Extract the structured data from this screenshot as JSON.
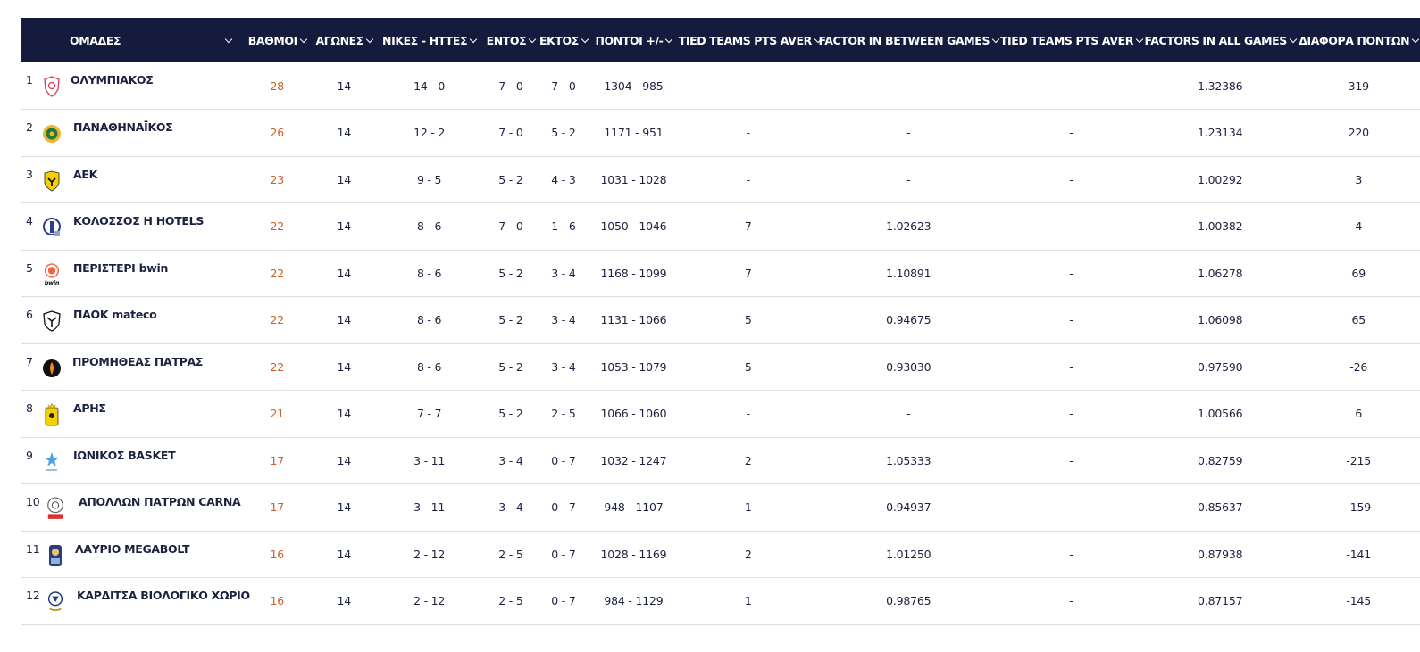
{
  "headers": {
    "team": "ΟΜΑΔΕΣ",
    "points": "ΒΑΘΜΟΙ",
    "games": "ΑΓΩΝΕΣ",
    "wl": "ΝΙΚΕΣ - ΗΤΤΕΣ",
    "home": "ΕΝΤΟΣ",
    "away": "ΕΚΤΟΣ",
    "ptsdiff": "ΠΟΝΤΟΙ +/-",
    "tied1": "TIED TEAMS PTS AVER",
    "factor_between": "FACTOR IN BETWEEN GAMES",
    "tied2": "TIED TEAMS PTS AVER",
    "factor_all": "FACTORS IN ALL GAMES",
    "diff": "ΔΙΑΦΟΡΑ ΠΟΝΤΩΝ"
  },
  "rows": [
    {
      "pos": "1",
      "team": "ΟΛΥΜΠΙΑΚΟΣ",
      "logo": "olympiakos-logo",
      "points": "28",
      "games": "14",
      "wl": "14 - 0",
      "home": "7 - 0",
      "away": "7 - 0",
      "ptsdiff": "1304 - 985",
      "tied1": "-",
      "factor_between": "-",
      "tied2": "-",
      "factor_all": "1.32386",
      "diff": "319"
    },
    {
      "pos": "2",
      "team": "ΠΑΝΑΘΗΝΑΪΚΟΣ",
      "logo": "panathinaikos-logo",
      "points": "26",
      "games": "14",
      "wl": "12 - 2",
      "home": "7 - 0",
      "away": "5 - 2",
      "ptsdiff": "1171 - 951",
      "tied1": "-",
      "factor_between": "-",
      "tied2": "-",
      "factor_all": "1.23134",
      "diff": "220"
    },
    {
      "pos": "3",
      "team": "ΑΕΚ",
      "logo": "aek-logo",
      "points": "23",
      "games": "14",
      "wl": "9 - 5",
      "home": "5 - 2",
      "away": "4 - 3",
      "ptsdiff": "1031 - 1028",
      "tied1": "-",
      "factor_between": "-",
      "tied2": "-",
      "factor_all": "1.00292",
      "diff": "3"
    },
    {
      "pos": "4",
      "team": "ΚΟΛΟΣΣΟΣ H HOTELS",
      "logo": "kolossos-logo",
      "points": "22",
      "games": "14",
      "wl": "8 - 6",
      "home": "7 - 0",
      "away": "1 - 6",
      "ptsdiff": "1050 - 1046",
      "tied1": "7",
      "factor_between": "1.02623",
      "tied2": "-",
      "factor_all": "1.00382",
      "diff": "4"
    },
    {
      "pos": "5",
      "team": "ΠΕΡΙΣΤΕΡΙ bwin",
      "logo": "peristeri-logo",
      "points": "22",
      "games": "14",
      "wl": "8 - 6",
      "home": "5 - 2",
      "away": "3 - 4",
      "ptsdiff": "1168 - 1099",
      "tied1": "7",
      "factor_between": "1.10891",
      "tied2": "-",
      "factor_all": "1.06278",
      "diff": "69"
    },
    {
      "pos": "6",
      "team": "ΠΑΟΚ mateco",
      "logo": "paok-logo",
      "points": "22",
      "games": "14",
      "wl": "8 - 6",
      "home": "5 - 2",
      "away": "3 - 4",
      "ptsdiff": "1131 - 1066",
      "tied1": "5",
      "factor_between": "0.94675",
      "tied2": "-",
      "factor_all": "1.06098",
      "diff": "65"
    },
    {
      "pos": "7",
      "team": "ΠΡΟΜΗΘΕΑΣ ΠΑΤΡΑΣ",
      "logo": "promitheas-logo",
      "points": "22",
      "games": "14",
      "wl": "8 - 6",
      "home": "5 - 2",
      "away": "3 - 4",
      "ptsdiff": "1053 - 1079",
      "tied1": "5",
      "factor_between": "0.93030",
      "tied2": "-",
      "factor_all": "0.97590",
      "diff": "-26"
    },
    {
      "pos": "8",
      "team": "ΑΡΗΣ",
      "logo": "aris-logo",
      "points": "21",
      "games": "14",
      "wl": "7 - 7",
      "home": "5 - 2",
      "away": "2 - 5",
      "ptsdiff": "1066 - 1060",
      "tied1": "-",
      "factor_between": "-",
      "tied2": "-",
      "factor_all": "1.00566",
      "diff": "6"
    },
    {
      "pos": "9",
      "team": "ΙΩΝΙΚΟΣ BASKET",
      "logo": "ionikos-logo",
      "points": "17",
      "games": "14",
      "wl": "3 - 11",
      "home": "3 - 4",
      "away": "0 - 7",
      "ptsdiff": "1032 - 1247",
      "tied1": "2",
      "factor_between": "1.05333",
      "tied2": "-",
      "factor_all": "0.82759",
      "diff": "-215"
    },
    {
      "pos": "10",
      "team": "ΑΠΟΛΛΩΝ ΠΑΤΡΩΝ CARNA",
      "logo": "apollon-logo",
      "points": "17",
      "games": "14",
      "wl": "3 - 11",
      "home": "3 - 4",
      "away": "0 - 7",
      "ptsdiff": "948 - 1107",
      "tied1": "1",
      "factor_between": "0.94937",
      "tied2": "-",
      "factor_all": "0.85637",
      "diff": "-159"
    },
    {
      "pos": "11",
      "team": "ΛΑΥΡΙΟ MEGABOLT",
      "logo": "lavrio-logo",
      "points": "16",
      "games": "14",
      "wl": "2 - 12",
      "home": "2 - 5",
      "away": "0 - 7",
      "ptsdiff": "1028 - 1169",
      "tied1": "2",
      "factor_between": "1.01250",
      "tied2": "-",
      "factor_all": "0.87938",
      "diff": "-141"
    },
    {
      "pos": "12",
      "team": "ΚΑΡΔΙΤΣΑ ΒΙΟΛΟΓΙΚΟ ΧΩΡΙΟ",
      "logo": "karditsa-logo",
      "points": "16",
      "games": "14",
      "wl": "2 - 12",
      "home": "2 - 5",
      "away": "0 - 7",
      "ptsdiff": "984 - 1129",
      "tied1": "1",
      "factor_between": "0.98765",
      "tied2": "-",
      "factor_all": "0.87157",
      "diff": "-145"
    }
  ],
  "colors": {
    "header_bg": "#141b3c",
    "points_text": "#c8612a",
    "row_border": "#dedede"
  }
}
